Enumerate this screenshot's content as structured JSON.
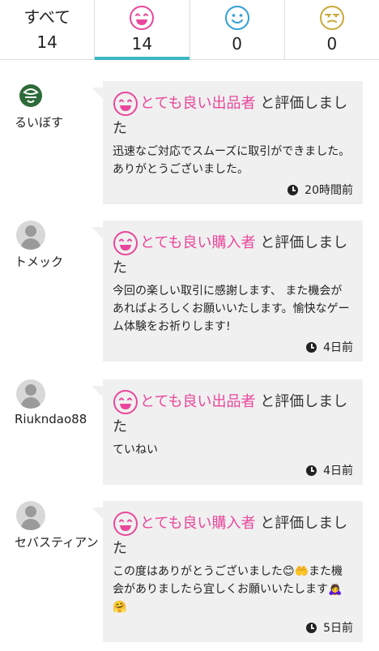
{
  "tabs": [
    {
      "label": "すべて",
      "count": "14"
    },
    {
      "icon": "smile-pink-icon",
      "count": "14"
    },
    {
      "icon": "smile-blue-icon",
      "count": "0"
    },
    {
      "icon": "meh-yellow-icon",
      "count": "0"
    }
  ],
  "colors": {
    "accent": "#3bb8c4",
    "pink": "#e8479b",
    "blue": "#2e9fd6",
    "yellow": "#c9a93a"
  },
  "reviews": [
    {
      "user": "るいぼす",
      "rating": "とても良い出品者",
      "suffix1": " と評価しまし",
      "suffix2": "た",
      "comment": "迅速なご対応でスムーズに取引ができました。ありがとうございました。",
      "time": "20時間前"
    },
    {
      "user": "トメック",
      "rating": "とても良い購入者",
      "suffix1": " と評価しまし",
      "suffix2": "た",
      "comment": "今回の楽しい取引に感謝します、 また機会があればよろしくお願いいたします。愉快なゲーム体験をお祈りします!",
      "time": "4日前"
    },
    {
      "user": "Riukndao88",
      "rating": "とても良い出品者",
      "suffix1": " と評価しまし",
      "suffix2": "た",
      "comment": "ていねい",
      "time": "4日前"
    },
    {
      "user": "セバスティアン",
      "rating": "とても良い購入者",
      "suffix1": " と評価しまし",
      "suffix2": "た",
      "comment": "この度はありがとうございました😊🤲また機会がありましたら宜しくお願いいたします🙇‍♀️🤗",
      "time": "5日前"
    }
  ]
}
